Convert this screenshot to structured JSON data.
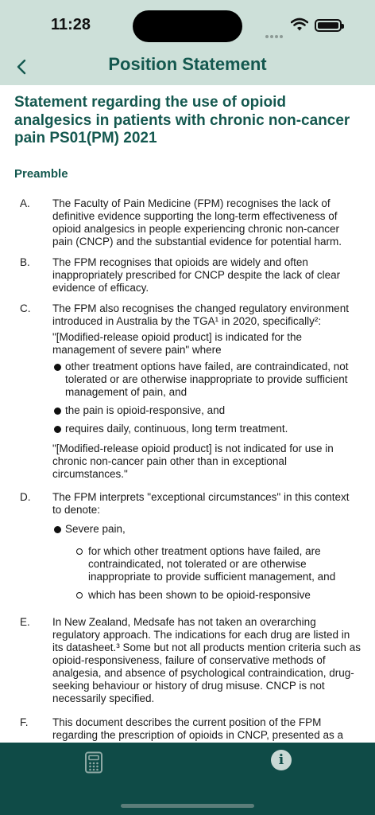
{
  "status_bar": {
    "time": "11:28"
  },
  "nav": {
    "title": "Position Statement"
  },
  "document": {
    "title": "Statement regarding the use of opioid analgesics in patients with chronic non-cancer pain PS01(PM) 2021",
    "section_heading": "Preamble",
    "item_a": {
      "letter": "A.",
      "text": "The Faculty of Pain Medicine (FPM) recognises the lack of definitive evidence supporting the long-term effectiveness of opioid analgesics in people experiencing chronic non-cancer pain (CNCP) and the substantial evidence for potential harm."
    },
    "item_b": {
      "letter": "B.",
      "text": "The FPM recognises that opioids are widely and often inappropriately prescribed for CNCP despite the lack of clear evidence of efficacy."
    },
    "item_c": {
      "letter": "C.",
      "text": "The FPM also recognises the changed regulatory environment introduced in Australia by the TGA¹ in 2020, specifically²:",
      "quote_1": "\"[Modified-release opioid product] is indicated for the management of severe pain\" where",
      "bullets": [
        "other treatment options have failed, are contraindicated, not tolerated or are otherwise inappropriate to provide sufficient management of pain, and",
        "the pain is opioid-responsive, and",
        "requires daily, continuous, long term treatment."
      ],
      "quote_2": "\"[Modified-release opioid product] is not indicated for use in chronic non-cancer pain other than in exceptional circumstances.\""
    },
    "item_d": {
      "letter": "D.",
      "text": "The FPM interprets \"exceptional circumstances\" in this context to denote:",
      "bullet": "Severe pain,",
      "sub_bullets": [
        "for which other treatment options have failed, are contraindicated, not tolerated or are otherwise inappropriate to provide sufficient management, and",
        "which has been shown to be opioid-responsive"
      ]
    },
    "item_e": {
      "letter": "E.",
      "text": "In New Zealand, Medsafe has not taken an overarching regulatory approach. The indications for each drug are listed in its datasheet.³ Some but not all products mention criteria such as opioid-responsiveness, failure of conservative methods of analgesia, and absence of psychological contraindication, drug-seeking behaviour or history of drug misuse. CNCP is not necessarily specified."
    },
    "item_f": {
      "letter": "F.",
      "text": "This document describes the current position of the FPM regarding the prescription of opioids in CNCP, presented as a"
    }
  },
  "tabbar": {
    "calculator_icon": "calculator-icon",
    "info_icon": "info-icon",
    "info_glyph": "i"
  },
  "colors": {
    "header_bg": "#cde0d9",
    "accent": "#14584f",
    "tabbar_bg": "#0f4b47"
  }
}
